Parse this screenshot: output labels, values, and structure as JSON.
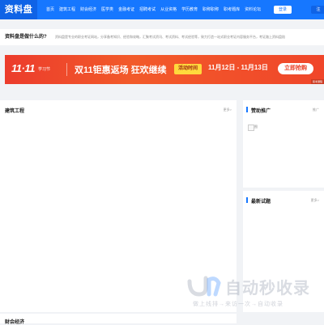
{
  "header": {
    "logo": "资料盘",
    "nav": [
      "首页",
      "建筑工程",
      "财会经济",
      "医学类 ",
      "金融考证",
      "招聘考试",
      "从业资格",
      "学历教育",
      "职称职称",
      "职考题库",
      "资料论坛"
    ],
    "login_label": "登录",
    "register_label": "注"
  },
  "intro": {
    "title": "资料盘是做什么的?",
    "text": "资料盘是专业的职业考证网站，分享备考知识、经验和攻略，汇聚考试资讯、考试资料、考试经验等，致力打造一站式职业考证内容服务平台，考证路上资料盘陪"
  },
  "banner": {
    "logo_num": "11·11",
    "logo_tag": "学习节",
    "headline": "双11钜惠返场 狂欢继续",
    "time_label": "活动时间",
    "time_value": "11月12日 - 11月13日",
    "cta": "立即抢购",
    "corner": "职考课程"
  },
  "panels": {
    "main": {
      "title": "建筑工程",
      "more": "更多>"
    },
    "sponsor": {
      "title": "赞助推广",
      "more": "推广",
      "item_label": "图"
    },
    "latest": {
      "title": "最新试题",
      "more": "更多>"
    },
    "bottom": {
      "title": "财会经济"
    }
  },
  "watermark": {
    "text": "自动秒收录",
    "sub": "做上线排→来访一次→自动收录"
  },
  "colors": {
    "brand": "#1677ff",
    "banner": "#ec3c2c",
    "cta_text": "#e9391f",
    "time_label_bg": "#ffd93d"
  }
}
